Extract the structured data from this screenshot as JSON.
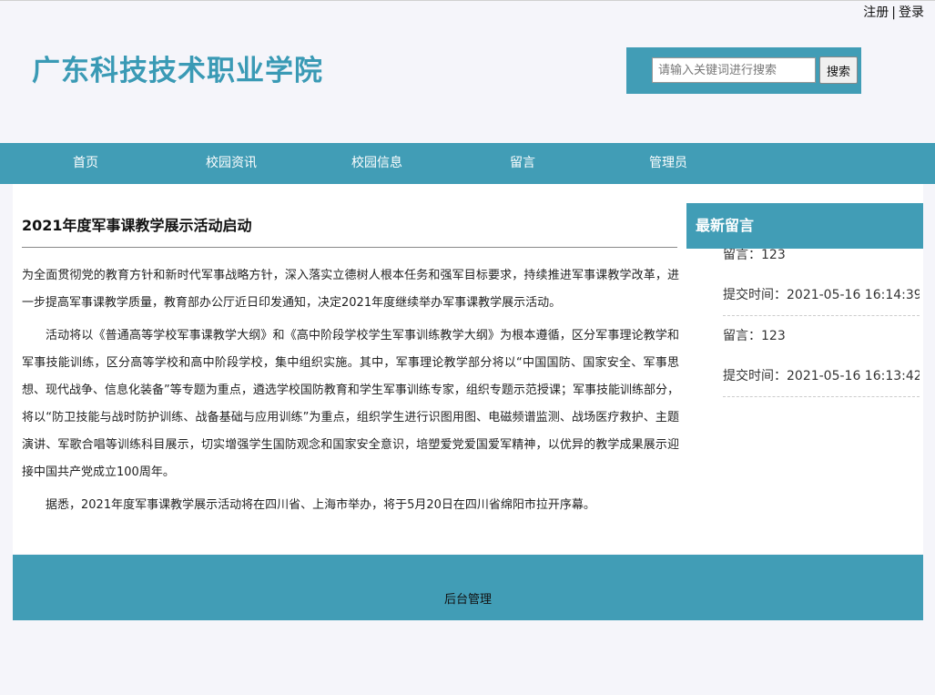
{
  "header": {
    "site_title": "广东科技技术职业学院",
    "register_label": "注册",
    "separator": "|",
    "login_label": "登录"
  },
  "search": {
    "placeholder": "请输入关键词进行搜索",
    "value": "",
    "button_label": "搜索"
  },
  "nav": {
    "items": [
      {
        "label": "首页"
      },
      {
        "label": "校园资讯"
      },
      {
        "label": "校园信息"
      },
      {
        "label": "留言"
      },
      {
        "label": "管理员"
      }
    ]
  },
  "article": {
    "title": "2021年度军事课教学展示活动启动",
    "paragraphs": [
      "为全面贯彻党的教育方针和新时代军事战略方针，深入落实立德树人根本任务和强军目标要求，持续推进军事课教学改革，进一步提高军事课教学质量，教育部办公厅近日印发通知，决定2021年度继续举办军事课教学展示活动。",
      "活动将以《普通高等学校军事课教学大纲》和《高中阶段学校学生军事训练教学大纲》为根本遵循，区分军事理论教学和军事技能训练，区分高等学校和高中阶段学校，集中组织实施。其中，军事理论教学部分将以“中国国防、国家安全、军事思想、现代战争、信息化装备”等专题为重点，遴选学校国防教育和学生军事训练专家，组织专题示范授课；军事技能训练部分，将以“防卫技能与战时防护训练、战备基础与应用训练”为重点，组织学生进行识图用图、电磁频谱监测、战场医疗救护、主题演讲、军歌合唱等训练科目展示，切实增强学生国防观念和国家安全意识，培塑爱党爱国爱军精神，以优异的教学成果展示迎接中国共产党成立100周年。",
      "据悉，2021年度军事课教学展示活动将在四川省、上海市举办，将于5月20日在四川省绵阳市拉开序幕。"
    ]
  },
  "sidebar": {
    "title": "最新留言",
    "messages": [
      {
        "message": "留言：123",
        "time": "提交时间：2021-05-16 16:14:39"
      },
      {
        "message": "留言：123",
        "time": "提交时间：2021-05-16 16:13:42"
      }
    ]
  },
  "footer": {
    "admin_link": "后台管理"
  },
  "colors": {
    "accent": "#419db6",
    "title": "#3a9ab5",
    "background": "#f5f5fa"
  }
}
